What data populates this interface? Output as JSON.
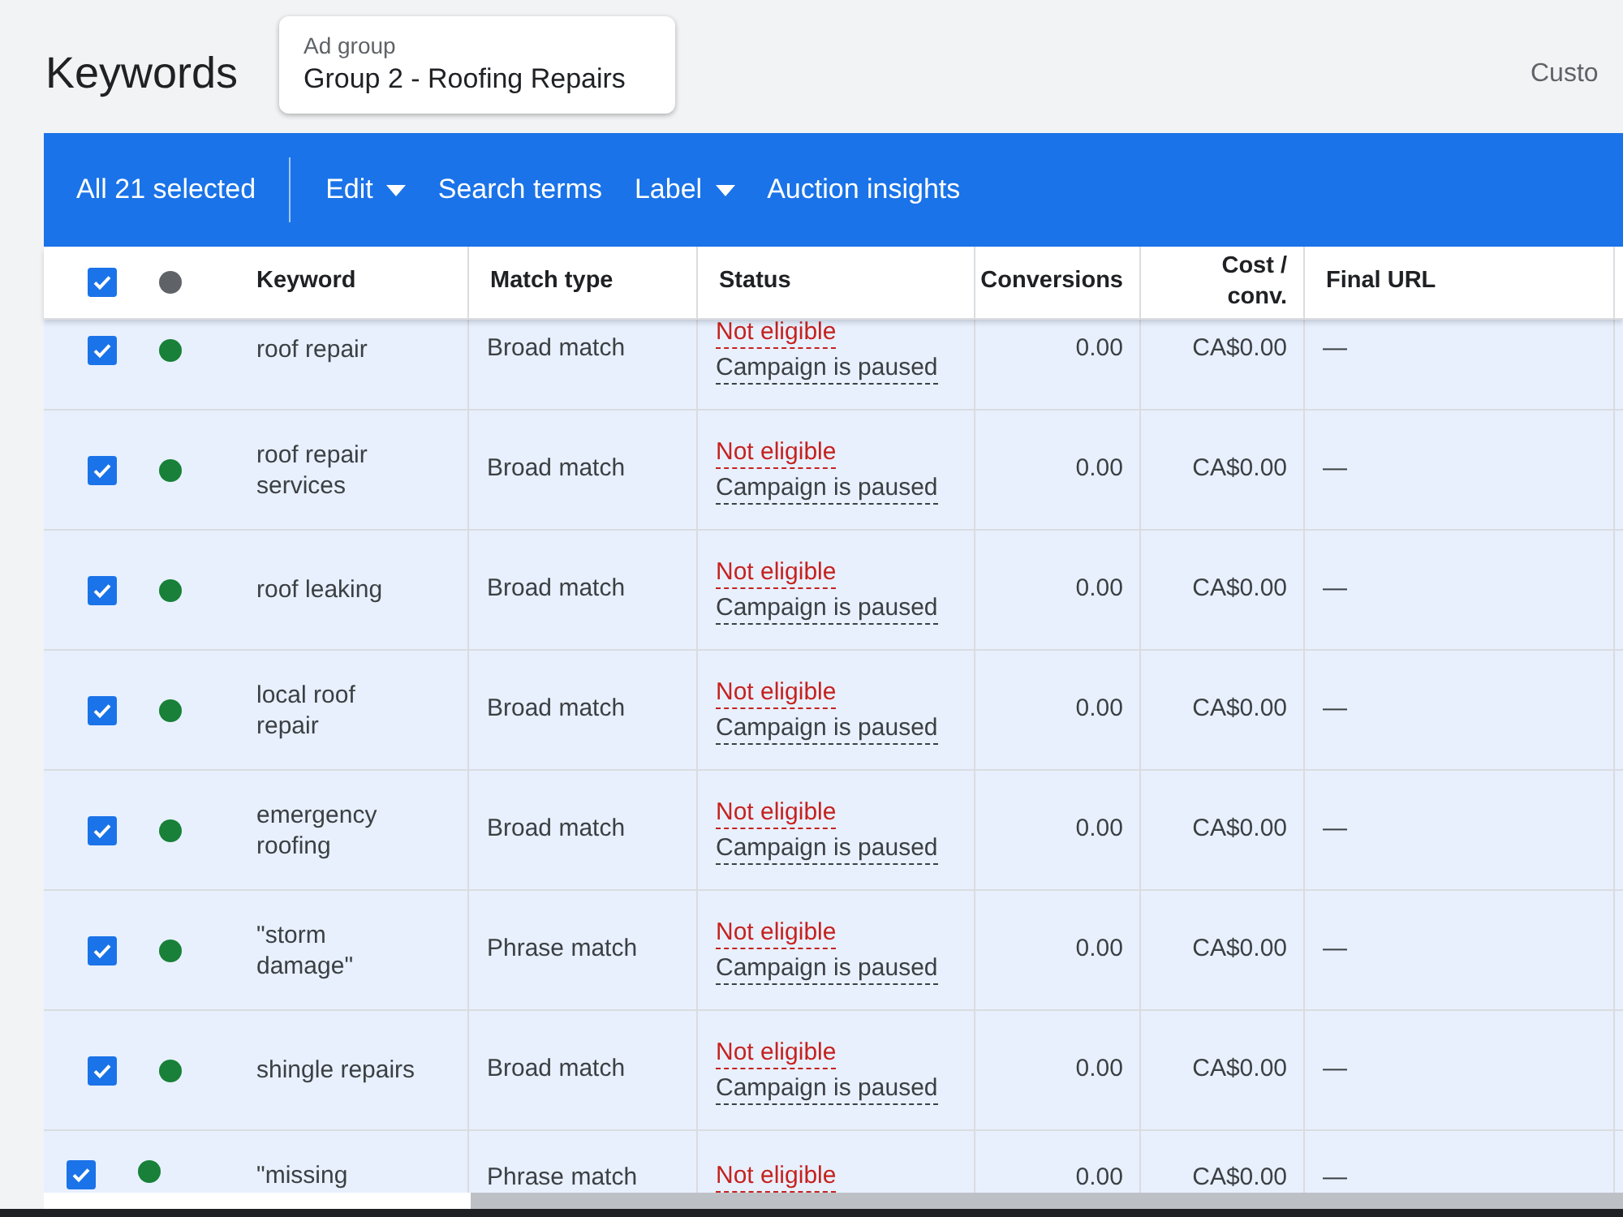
{
  "page": {
    "title": "Keywords",
    "ad_group": {
      "label": "Ad group",
      "value": "Group 2 - Roofing Repairs"
    },
    "right_text": "Custo"
  },
  "toolbar": {
    "selection": "All 21 selected",
    "actions": [
      {
        "label": "Edit",
        "dropdown": true
      },
      {
        "label": "Search terms",
        "dropdown": false
      },
      {
        "label": "Label",
        "dropdown": true
      },
      {
        "label": "Auction insights",
        "dropdown": false
      }
    ]
  },
  "table": {
    "select_all": {
      "checked": true
    },
    "columns": [
      "Keyword",
      "Match type",
      "Status",
      "Conversions",
      "Cost / conv.",
      "Final URL"
    ],
    "rows": [
      {
        "checked": true,
        "color": "#188038",
        "keyword": "roof repair",
        "match_type": "Broad match",
        "status": "Not eligible",
        "reason": "Campaign is paused",
        "conversions": "0.00",
        "cost": "CA$0.00",
        "final_url": "—"
      },
      {
        "checked": true,
        "color": "#188038",
        "keyword": "roof repair services",
        "match_type": "Broad match",
        "status": "Not eligible",
        "reason": "Campaign is paused",
        "conversions": "0.00",
        "cost": "CA$0.00",
        "final_url": "—"
      },
      {
        "checked": true,
        "color": "#188038",
        "keyword": "roof leaking",
        "match_type": "Broad match",
        "status": "Not eligible",
        "reason": "Campaign is paused",
        "conversions": "0.00",
        "cost": "CA$0.00",
        "final_url": "—"
      },
      {
        "checked": true,
        "color": "#188038",
        "keyword": "local roof repair",
        "match_type": "Broad match",
        "status": "Not eligible",
        "reason": "Campaign is paused",
        "conversions": "0.00",
        "cost": "CA$0.00",
        "final_url": "—"
      },
      {
        "checked": true,
        "color": "#188038",
        "keyword": "emergency roofing",
        "match_type": "Broad match",
        "status": "Not eligible",
        "reason": "Campaign is paused",
        "conversions": "0.00",
        "cost": "CA$0.00",
        "final_url": "—"
      },
      {
        "checked": true,
        "color": "#188038",
        "keyword": "\"storm damage\"",
        "match_type": "Phrase match",
        "status": "Not eligible",
        "reason": "Campaign is paused",
        "conversions": "0.00",
        "cost": "CA$0.00",
        "final_url": "—"
      },
      {
        "checked": true,
        "color": "#188038",
        "keyword": "shingle repairs",
        "match_type": "Broad match",
        "status": "Not eligible",
        "reason": "Campaign is paused",
        "conversions": "0.00",
        "cost": "CA$0.00",
        "final_url": "—"
      },
      {
        "checked": true,
        "color": "#188038",
        "keyword": "\"missing",
        "match_type": "Phrase match",
        "status": "Not eligible",
        "conversions": "0.00",
        "cost": "CA$0.00",
        "final_url": "—"
      }
    ]
  }
}
